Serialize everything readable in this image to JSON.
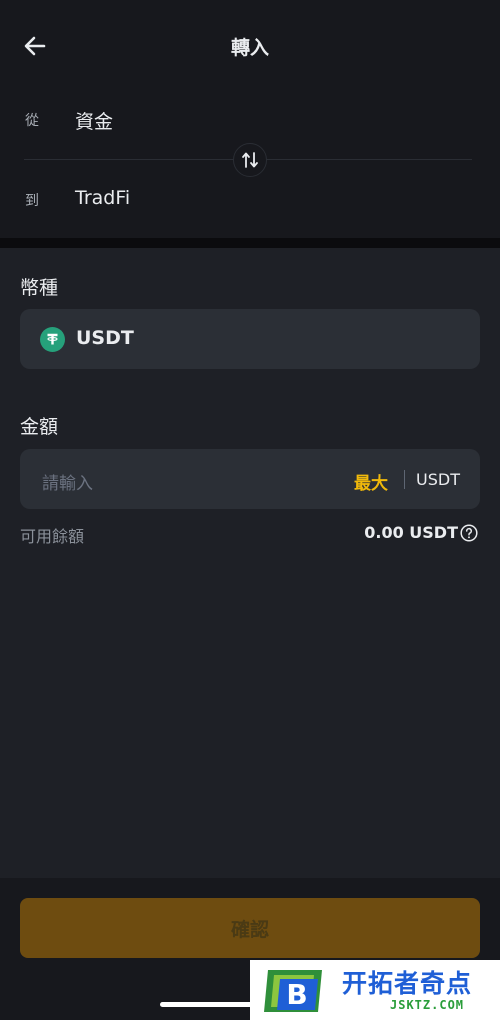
{
  "header": {
    "title": "轉入"
  },
  "transfer": {
    "from_label": "從",
    "from_value": "資金",
    "to_label": "到",
    "to_value": "TradFi"
  },
  "currency": {
    "label": "幣種",
    "value": "USDT",
    "icon": "tether-icon"
  },
  "amount": {
    "label": "金額",
    "placeholder": "請輸入",
    "max_label": "最大",
    "unit": "USDT"
  },
  "available": {
    "label": "可用餘額",
    "value": "0.00 USDT"
  },
  "confirm_label": "確認",
  "watermark": {
    "name": "开拓者奇点",
    "url": "JSKTZ.COM",
    "logo_letter": "B"
  },
  "colors": {
    "accent": "#f0b90b",
    "tether": "#26a17b",
    "background": "#1e2026"
  }
}
